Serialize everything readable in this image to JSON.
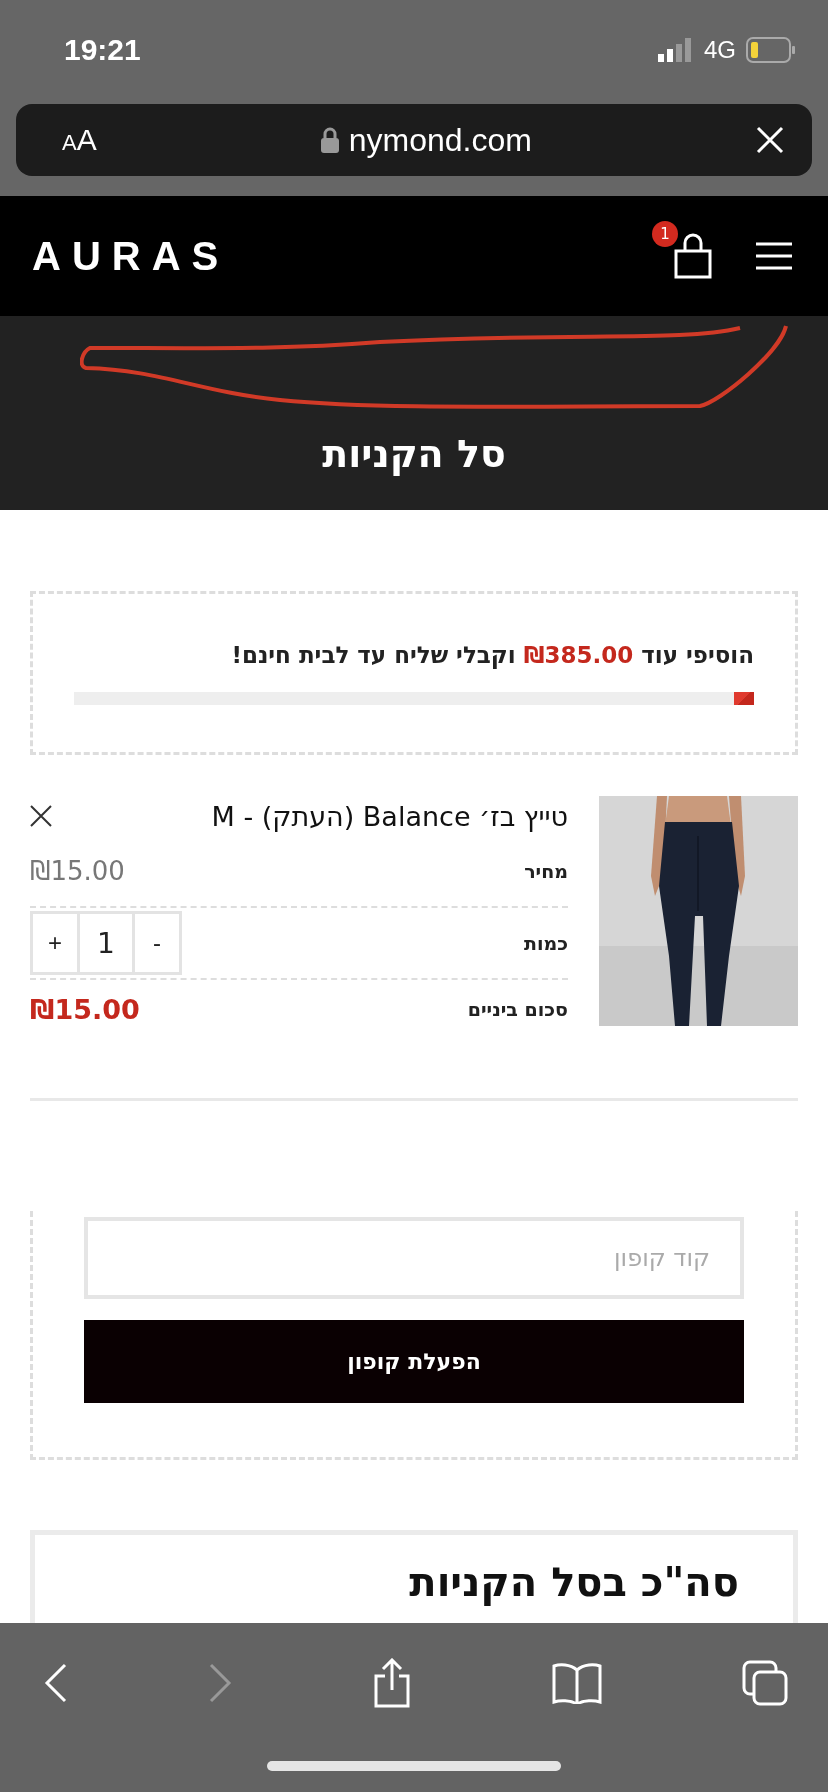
{
  "status_bar": {
    "time": "19:21",
    "network": "4G"
  },
  "browser": {
    "text_size_button": "AA",
    "url": "nymond.com"
  },
  "header": {
    "logo": "AURAS",
    "cart_count": "1"
  },
  "page_title": "סל הקניות",
  "free_shipping": {
    "text_before": "הוסיפי עוד",
    "amount": "₪385.00",
    "text_after": "וקבלי שליח עד לבית חינם!",
    "level": 0.03
  },
  "cart_item": {
    "kind": "picture",
    "title": "טייץ בז׳ Balance (העתק) - M",
    "price_label": "מחיר",
    "price": "₪15.00",
    "quantity_label": "כמות",
    "minus": "-",
    "quantity": "1",
    "plus": "+",
    "subtotal_label": "סכום ביניים",
    "subtotal": "₪15.00"
  },
  "coupon": {
    "placeholder": "קוד קופון",
    "button": "הפעלת קופון"
  },
  "totals": {
    "heading": "סה\"כ בסל הקניות"
  },
  "toolbar": {
    "forward_disabled": true
  }
}
